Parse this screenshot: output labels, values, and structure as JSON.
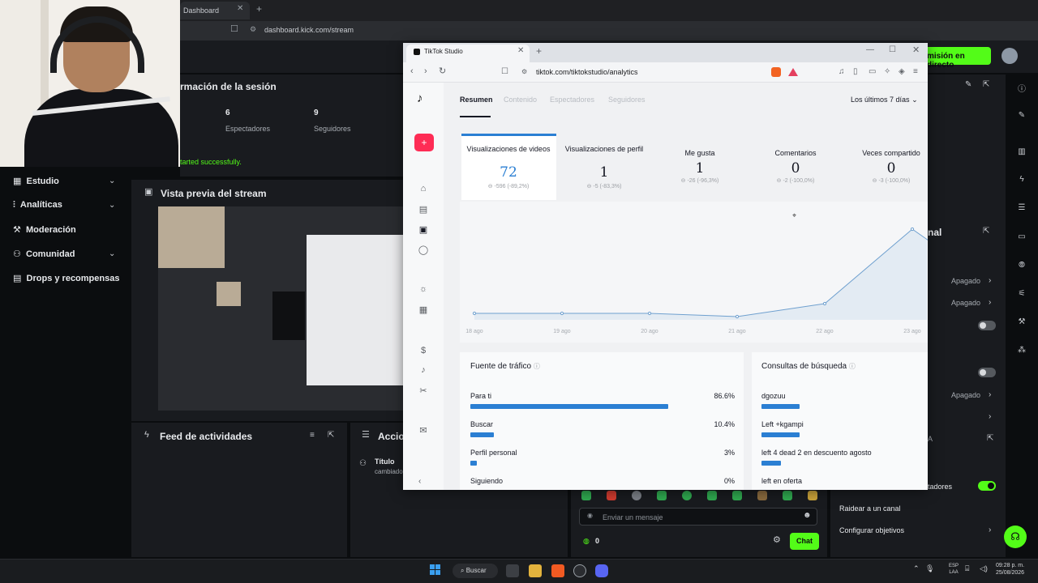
{
  "kick": {
    "tab_title": "Dashboard",
    "url": "dashboard.kick.com/stream",
    "live_button": "misión en directo",
    "session_title": "rmación de la sesión",
    "stats": [
      {
        "value": "6",
        "label": "Espectadores"
      },
      {
        "value": "9",
        "label": "Seguidores"
      }
    ],
    "start_message": "tarted successfully.",
    "sidebar": [
      {
        "label": "Estudio",
        "has_chevron": true
      },
      {
        "label": "Analíticas",
        "has_chevron": true
      },
      {
        "label": "Moderación",
        "has_chevron": false
      },
      {
        "label": "Comunidad",
        "has_chevron": true
      },
      {
        "label": "Drops y recompensas",
        "has_chevron": false
      }
    ],
    "preview_title": "Vista previa del stream",
    "feed_title": "Feed de actividades",
    "actions_title": "Accio",
    "action_item": {
      "title": "Título",
      "subtitle": "cambiado"
    },
    "chat": {
      "placeholder": "Enviar un mensaje",
      "viewer_count": "0",
      "send_label": "Chat"
    },
    "right_panel": {
      "title_fragment": "nal",
      "values": [
        "Apagado",
        "Apagado",
        "Apagado"
      ],
      "viewers_fragment": "tadores",
      "raid_label": "Raidear a un canal",
      "goals_label": "Configurar objetivos",
      "letter_a": "A"
    },
    "accent_color": "#53fc18"
  },
  "tiktok": {
    "tab_title": "TikTok Studio",
    "url": "tiktok.com/tiktokstudio/analytics",
    "nav_tabs": [
      "Resumen",
      "Contenido",
      "Espectadores",
      "Seguidores"
    ],
    "active_tab": "Resumen",
    "period": "Los últimos 7 días",
    "metrics": [
      {
        "label": "Visualizaciones de videos",
        "value": "72",
        "change": "-596 (-89,2%)"
      },
      {
        "label": "Visualizaciones de perfil",
        "value": "1",
        "change": "-5 (-83,3%)"
      },
      {
        "label": "Me gusta",
        "value": "1",
        "change": "-26 (-96,3%)"
      },
      {
        "label": "Comentarios",
        "value": "0",
        "change": "-2 (-100,0%)"
      },
      {
        "label": "Veces compartido",
        "value": "0",
        "change": "-3 (-100,0%)"
      }
    ],
    "chart_data": {
      "type": "area",
      "x": [
        "18 ago",
        "19 ago",
        "20 ago",
        "21 ago",
        "22 ago",
        "23 ago"
      ],
      "series": [
        {
          "values": [
            1,
            1,
            0,
            0.5,
            2.5,
            14
          ]
        }
      ],
      "title": "",
      "xlabel": "",
      "ylabel": ""
    },
    "traffic": {
      "title": "Fuente de tráfico",
      "rows": [
        {
          "label": "Para ti",
          "pct": "86.6%",
          "value": 86.6
        },
        {
          "label": "Buscar",
          "pct": "10.4%",
          "value": 10.4
        },
        {
          "label": "Perfil personal",
          "pct": "3%",
          "value": 3
        },
        {
          "label": "Siguiendo",
          "pct": "0%",
          "value": 0
        }
      ]
    },
    "search": {
      "title": "Consultas de búsqueda",
      "rows": [
        {
          "label": "dgozuu",
          "value": 0.22
        },
        {
          "label": "Left +kgampi",
          "value": 0.22
        },
        {
          "label": "left 4 dead 2 en descuento agosto",
          "value": 0.11
        },
        {
          "label": "left en oferta",
          "value": 0
        }
      ]
    },
    "accent_color": "#2b7fd3",
    "brand_color": "#fe2c55"
  },
  "taskbar": {
    "search_label": "Buscar",
    "lang_line1": "ESP",
    "lang_line2": "LAA",
    "time": "09:28 p. m.",
    "date": "25/08/2026"
  }
}
